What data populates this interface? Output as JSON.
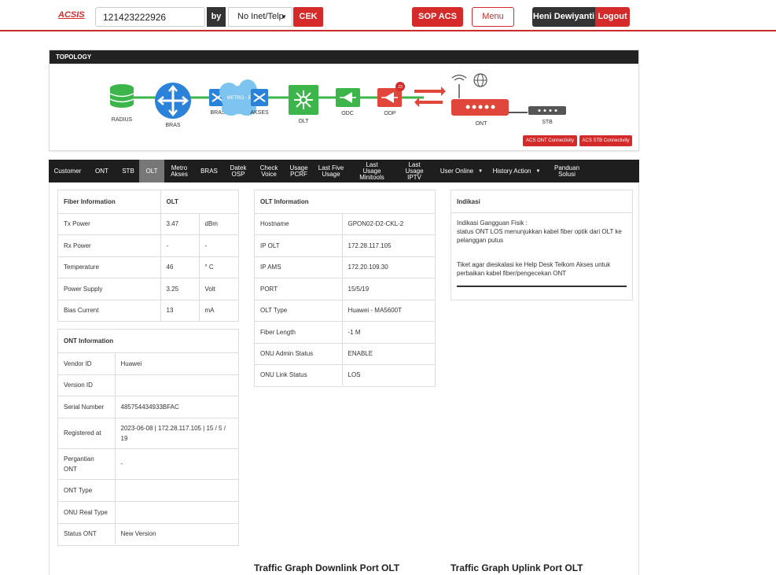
{
  "header": {
    "logo": "ACSIS",
    "search_value": "121423222926",
    "by_label": "by",
    "search_type": "No Inet/Telp",
    "cek_label": "CEK",
    "sop_label": "SOP ACS",
    "menu_label": "Menu",
    "user_name": "Heni Dewiyanti",
    "logout_label": "Logout"
  },
  "topology": {
    "title": "TOPOLOGY",
    "nodes": {
      "radius": "RADIUS",
      "bras": "BRAS",
      "bras2": "BRAS",
      "metro": "METRO - E",
      "akses": "AKSES",
      "olt": "OLT",
      "odc": "ODC",
      "odp": "ODP",
      "odp_badge": "23",
      "ont": "ONT",
      "stb": "STB"
    },
    "acs_ont_label": "ACS ONT Connectivity",
    "acs_stb_label": "ACS STB Connectivity",
    "colors": {
      "green": "#3cb54a",
      "blue": "#2b82d9",
      "red": "#e0463a",
      "dark": "#555555"
    }
  },
  "tabs": [
    {
      "label": "Customer"
    },
    {
      "label": "ONT"
    },
    {
      "label": "STB"
    },
    {
      "label": "OLT",
      "active": true
    },
    {
      "label": "Metro Akses"
    },
    {
      "label": "BRAS"
    },
    {
      "label": "Datek OSP"
    },
    {
      "label": "Check Voice"
    },
    {
      "label": "Usage PCRF"
    },
    {
      "label": "Last Five Usage"
    },
    {
      "label": "Last Usage Minitools"
    },
    {
      "label": "Last Usage IPTV"
    },
    {
      "label": "User Online"
    },
    {
      "label": "History Action"
    },
    {
      "label": "Panduan Solusi"
    }
  ],
  "fiber": {
    "title": "Fiber Information",
    "col": "OLT",
    "rows": [
      {
        "label": "Tx Power",
        "value": "3.47",
        "unit": "dBm"
      },
      {
        "label": "Rx Power",
        "value": "-",
        "unit": "-"
      },
      {
        "label": "Temperature",
        "value": "46",
        "unit": "° C"
      },
      {
        "label": "Power Supply",
        "value": "3.25",
        "unit": "Volt"
      },
      {
        "label": "Bias Current",
        "value": "13",
        "unit": "mA"
      }
    ]
  },
  "ont": {
    "title": "ONT Information",
    "rows": [
      {
        "label": "Vendor ID",
        "value": "Huawei"
      },
      {
        "label": "Version ID",
        "value": ""
      },
      {
        "label": "Serial Number",
        "value": "485754434933BFAC"
      },
      {
        "label": "Registered at",
        "value": "2023-06-08 | 172.28.117.105 | 15 / 5 / 19"
      },
      {
        "label": "Pergantian ONT",
        "value": "-"
      },
      {
        "label": "ONT Type",
        "value": ""
      },
      {
        "label": "ONU Real Type",
        "value": ""
      },
      {
        "label": "Status ONT",
        "value": "New Version"
      }
    ]
  },
  "olt": {
    "title": "OLT Information",
    "rows": [
      {
        "label": "Hostname",
        "value": "GPON02-D2-CKL-2"
      },
      {
        "label": "IP OLT",
        "value": "172.28.117.105"
      },
      {
        "label": "IP AMS",
        "value": "172.20.109.30"
      },
      {
        "label": "PORT",
        "value": "15/5/19"
      },
      {
        "label": "OLT Type",
        "value": "Huawei - MA5600T"
      },
      {
        "label": "Fiber Length",
        "value": "-1 M"
      },
      {
        "label": "ONU Admin Status",
        "value": "ENABLE"
      },
      {
        "label": "ONU Link Status",
        "value": "LOS"
      }
    ]
  },
  "indikasi": {
    "title": "Indikasi",
    "line1": "Indikasi Gangguan Fisik :",
    "line2": "status ONT LOS menunjukkan kabel fiber optik dari OLT ke pelanggan putus",
    "line3": "Tiket agar dieskalasi ke Help Desk Telkom Akses untuk perbaikan kabel fiber/pengecekan ONT"
  },
  "graphs": {
    "downlink": "Traffic Graph Downlink Port OLT",
    "uplink": "Traffic Graph Uplink Port OLT"
  }
}
